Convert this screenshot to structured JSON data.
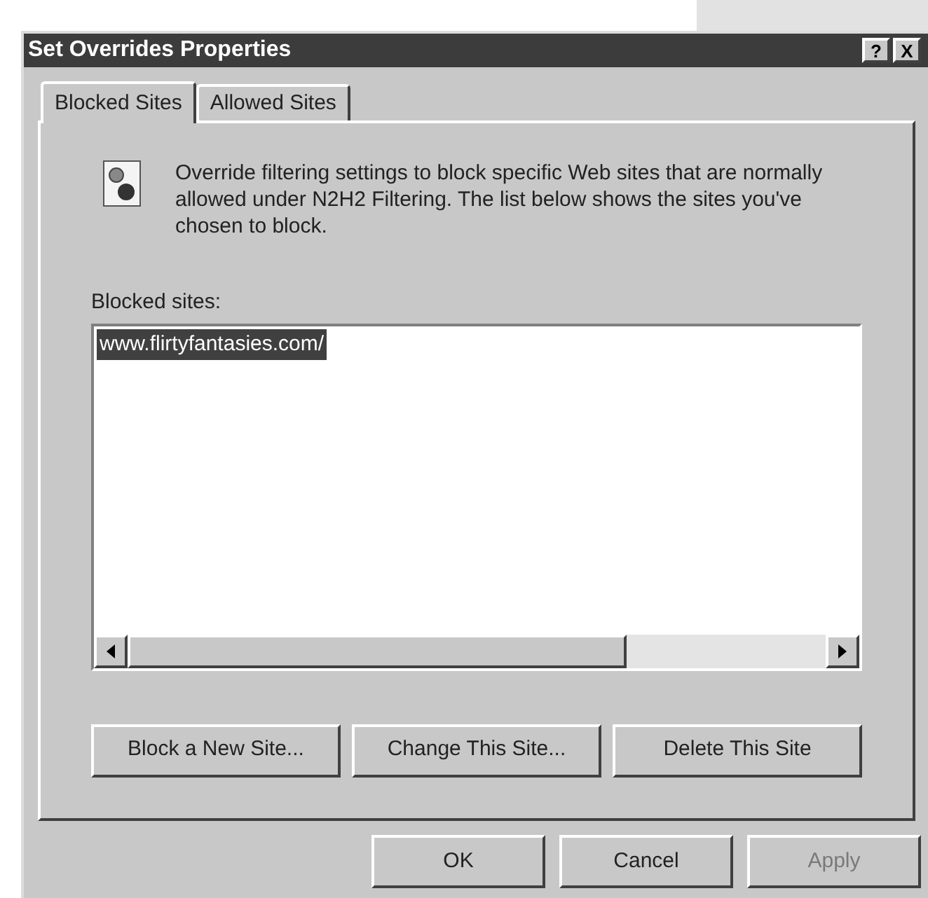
{
  "window": {
    "title": "Set Overrides Properties",
    "help_button": "?",
    "close_button": "X"
  },
  "tabs": [
    {
      "label": "Blocked Sites",
      "selected": true
    },
    {
      "label": "Allowed Sites",
      "selected": false
    }
  ],
  "description": "Override filtering settings to block specific Web sites that are normally allowed under N2H2 Filtering. The list below shows the sites you've chosen to block.",
  "list_label": "Blocked sites:",
  "sites": [
    {
      "text": "www.flirtyfantasies.com/",
      "selected": true
    }
  ],
  "site_buttons": [
    {
      "label": "Block a New Site..."
    },
    {
      "label": "Change This Site..."
    },
    {
      "label": "Delete This Site"
    }
  ],
  "dialog_buttons": [
    {
      "label": "OK",
      "disabled": false
    },
    {
      "label": "Cancel",
      "disabled": false
    },
    {
      "label": "Apply",
      "disabled": true
    }
  ]
}
